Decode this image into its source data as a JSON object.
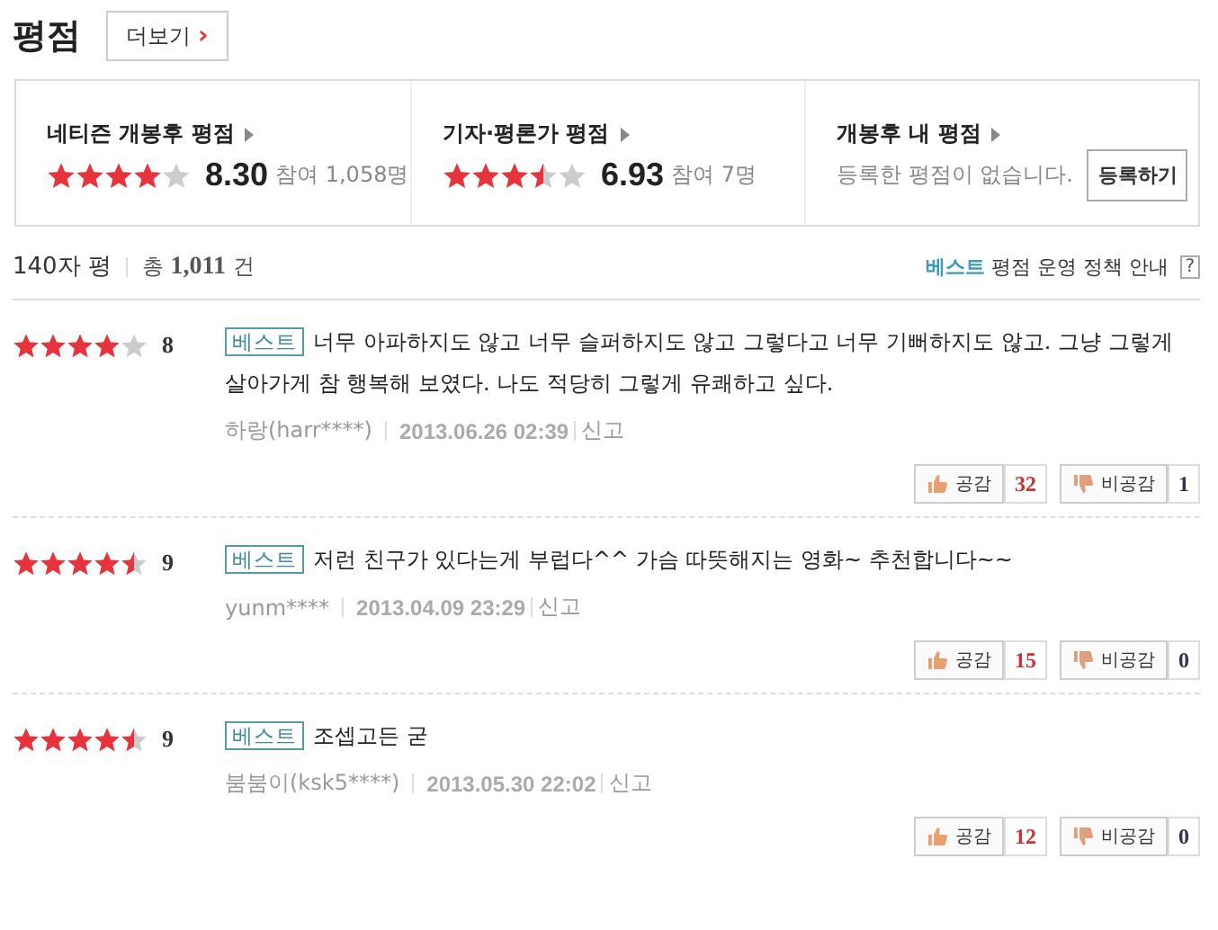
{
  "header": {
    "title": "평점",
    "more_button": "더보기",
    "more_caret": "›"
  },
  "summary": [
    {
      "kind": "score",
      "label": "네티즌 개봉후 평점",
      "stars": 4,
      "score": "8.30",
      "participants": "참여 1,058명"
    },
    {
      "kind": "score",
      "label": "기자·평론가 평점",
      "stars": 3.5,
      "score": "6.93",
      "participants": "참여 7명"
    },
    {
      "kind": "mine",
      "label": "개봉후 내 평점",
      "message": "등록한 평점이 없습니다.",
      "button": "등록하기"
    }
  ],
  "list_header": {
    "title": "140자 평",
    "total_label": "총",
    "total": "1,011",
    "total_unit": "건",
    "policy_highlight": "베스트",
    "policy_text": "평점 운영 정책 안내",
    "help": "?"
  },
  "reviews": [
    {
      "stars": 4,
      "score": "8",
      "badge": "베스트",
      "text": "너무 아파하지도 않고 너무 슬퍼하지도 않고 그렇다고 너무 기뻐하지도 않고. 그냥 그렇게 살아가게 참 행복해 보였다. 나도 적당히 그렇게 유쾌하고 싶다.",
      "author": "하랑(harr****)",
      "date": "2013.06.26 02:39",
      "report": "신고",
      "like_label": "공감",
      "likes": "32",
      "dislike_label": "비공감",
      "dislikes": "1"
    },
    {
      "stars": 4.5,
      "score": "9",
      "badge": "베스트",
      "text": "저런 친구가 있다는게 부럽다^^ 가슴 따뜻해지는 영화~ 추천합니다~~",
      "author": "yunm****",
      "date": "2013.04.09 23:29",
      "report": "신고",
      "like_label": "공감",
      "likes": "15",
      "dislike_label": "비공감",
      "dislikes": "0"
    },
    {
      "stars": 4.5,
      "score": "9",
      "badge": "베스트",
      "text": "조셉고든 굳",
      "author": "붐붐이(ksk5****)",
      "date": "2013.05.30 22:02",
      "report": "신고",
      "like_label": "공감",
      "likes": "12",
      "dislike_label": "비공감",
      "dislikes": "0"
    }
  ]
}
